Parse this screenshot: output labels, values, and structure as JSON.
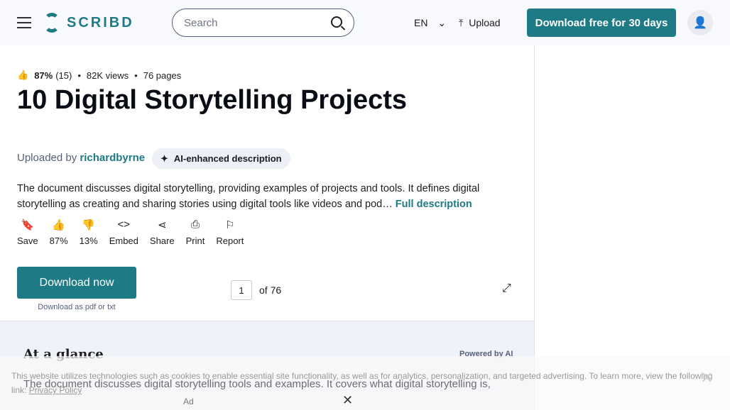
{
  "header": {
    "logo": "SCRIBD",
    "search_placeholder": "Search",
    "lang": "EN",
    "upload": "Upload",
    "download_free": "Download free for 30 days"
  },
  "meta": {
    "rating": "87%",
    "rating_count": "(15)",
    "views": "82K views",
    "pages": "76 pages"
  },
  "title": "10 Digital Storytelling Projects",
  "uploaded_by_label": "Uploaded by",
  "uploader": "richardbyrne",
  "ai_badge": "AI-enhanced description",
  "description": "The document discusses digital storytelling, providing examples of projects and tools. It defines digital storytelling as creating and sharing stories using digital tools like videos and pod…",
  "full_description": "Full description",
  "actions": [
    {
      "label": "Save",
      "icon": "bookmark"
    },
    {
      "label": "87%",
      "icon": "thumbs-up"
    },
    {
      "label": "13%",
      "icon": "thumbs-down"
    },
    {
      "label": "Embed",
      "icon": "code"
    },
    {
      "label": "Share",
      "icon": "share"
    },
    {
      "label": "Print",
      "icon": "printer"
    },
    {
      "label": "Report",
      "icon": "flag"
    }
  ],
  "download_now": "Download now",
  "download_sub": "Download as pdf or txt",
  "page": {
    "current": "1",
    "of": "of 76"
  },
  "glance": {
    "title": "At a glance",
    "powered": "Powered by AI",
    "text": "The document discusses digital storytelling tools and examples. It covers what digital storytelling is,"
  },
  "cookie": {
    "text": "This website utilizes technologies such as cookies to enable essential site functionality, as well as for analytics, personalization, and targeted advertising. To learn more, view the following link:",
    "link": "Privacy Policy"
  },
  "ad": {
    "label": "Ad"
  }
}
